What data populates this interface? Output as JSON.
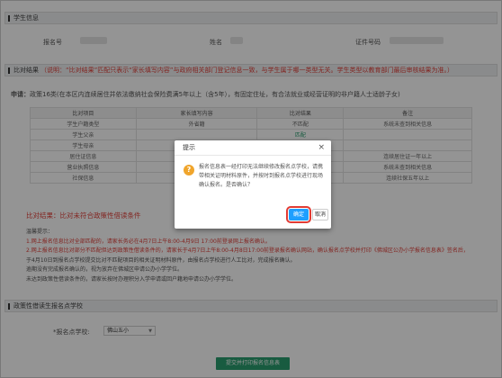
{
  "student_info": {
    "section_title": "学生信息",
    "reg_no_label": "报名号",
    "name_label": "姓名",
    "id_label": "证件号码"
  },
  "compare": {
    "section_title": "比对结果",
    "note": "（说明：“比对结果”匹配只表示“家长填写内容”与政府相关部门登记信息一致，与学生属于哪一类型无关。学生类型以教育部门最后审核结果为准。）",
    "applying_prefix": "申请：",
    "applying_text": "政策16类(在本区内连续居住并依法缴纳社会保险费满5年以上（含5年），有固定住址，有合法就业或经营证明的非户籍人士适龄子女)"
  },
  "table": {
    "headers": [
      "比对项目",
      "家长填写内容",
      "比对结果",
      "备注"
    ],
    "rows": [
      [
        "学生户籍类型",
        "外省籍",
        "不匹配",
        "系统未查到相关信息"
      ],
      [
        "学生父亲",
        "",
        "匹配",
        ""
      ],
      [
        "学生母亲",
        "",
        "",
        ""
      ],
      [
        "居住证信息",
        "",
        "",
        "连续居住证一年以上"
      ],
      [
        "营业执照信息",
        "",
        "",
        "系统未查到相关信息"
      ],
      [
        "社保信息",
        "",
        "",
        "连续社保五年以上"
      ]
    ]
  },
  "result_line": "比对结果：比对未符合政策性借读条件",
  "notes": {
    "title": "温馨提示：",
    "lines": [
      "1.网上报名信息比对全部匹配的，请家长务必在4月7日上午8:00-4月9日 17:00前登录网上报名确认。",
      "2.网上报名信息比对部分不匹配但达到政策性借读条件的，请家长于4月7日上午8:00-4月8日17:00前登录报名确认网站，确认报名点学校并打印《佛城区公办小学报名信息表》签名后，",
      "  于4月10日到报名点学校提交比对不匹配项目的相关证明材料原件，由报名点学校进行人工比对，完成报名确认。",
      "  逾期没有完成报名确认的，视为放弃在佛城区申请公办小学学位。",
      "  未达到政策性借读条件的，请家长按时办理积分入学申请或回户籍地申请公办小学学位。"
    ]
  },
  "school_section": {
    "section_title": "政策性借读生报名点学校",
    "select_label": "*报名点学校:",
    "select_value": "佛山五小",
    "submit_label": "提交并打印报名信息表"
  },
  "dialog": {
    "title": "提示",
    "close": "×",
    "icon_glyph": "?",
    "message": "报名信息表一经打印无法继续修改报名点学校，请携带相关证明材料原件，并按时到报名点学校进行现场确认报名。是否确认？",
    "ok_label": "确定",
    "cancel_label": "取消"
  }
}
